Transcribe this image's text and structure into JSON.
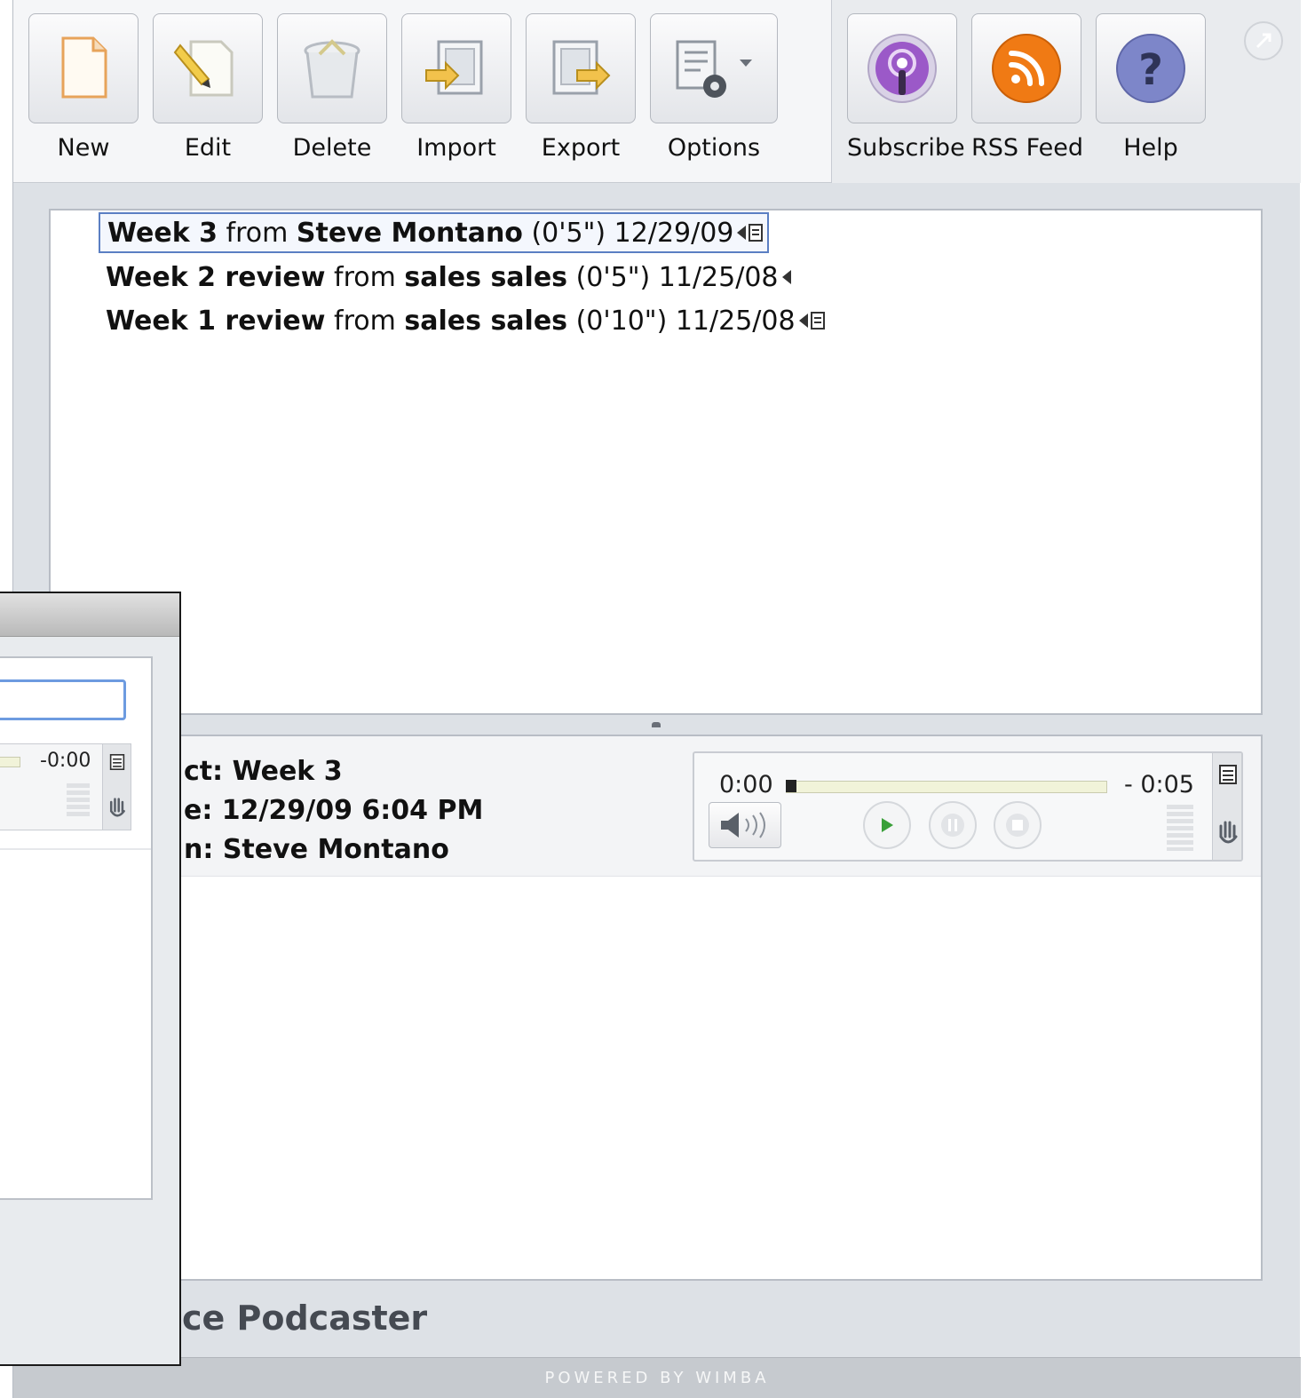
{
  "toolbar": {
    "left_buttons": [
      {
        "label": "New",
        "icon": "new-document-icon"
      },
      {
        "label": "Edit",
        "icon": "pencil-icon"
      },
      {
        "label": "Delete",
        "icon": "trash-icon"
      },
      {
        "label": "Import",
        "icon": "import-icon"
      },
      {
        "label": "Export",
        "icon": "export-icon"
      },
      {
        "label": "Options",
        "icon": "options-gear-icon"
      }
    ],
    "right_buttons": [
      {
        "label": "Subscribe",
        "icon": "podcast-icon"
      },
      {
        "label": "RSS Feed",
        "icon": "rss-icon"
      },
      {
        "label": "Help",
        "icon": "help-icon"
      }
    ]
  },
  "messages": [
    {
      "title": "Week 3",
      "from_word": "from",
      "sender": "Steve Montano",
      "duration": "(0'5\")",
      "date": "12/29/09",
      "selected": true
    },
    {
      "title": "Week 2 review",
      "from_word": "from",
      "sender": "sales sales",
      "duration": "(0'5\")",
      "date": "11/25/08",
      "selected": false
    },
    {
      "title": "Week 1 review",
      "from_word": "from",
      "sender": "sales sales",
      "duration": "(0'10\")",
      "date": "11/25/08",
      "selected": false
    }
  ],
  "detail": {
    "subject_label": "ct:",
    "subject": "Week 3",
    "date_label": "e:",
    "date": "12/29/09 6:04 PM",
    "from_label": "n:",
    "from": "Steve Montano"
  },
  "player": {
    "elapsed": "0:00",
    "remaining": "- 0:05",
    "progress_fraction": 0.0
  },
  "secondary_window": {
    "player_remaining": "-0:00"
  },
  "brand_text": "ce Podcaster",
  "footer_text": "POWERED BY WIMBA",
  "colors": {
    "selection_border": "#5b7fc3",
    "rss_orange": "#f07a14",
    "podcast_purple": "#9b59c8",
    "help_blue": "#7d86c9",
    "play_green": "#3aa03a"
  }
}
